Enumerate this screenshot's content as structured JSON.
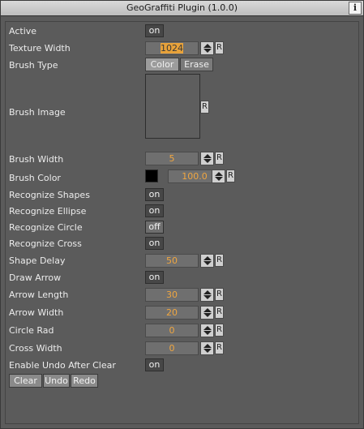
{
  "window": {
    "title": "GeoGraffiti Plugin (1.0.0)",
    "info_label": "i"
  },
  "common": {
    "reset_label": "R"
  },
  "rows": {
    "active": {
      "label": "Active",
      "toggle": "on"
    },
    "texture_width": {
      "label": "Texture Width",
      "value_a": "1",
      "value_b": "024"
    },
    "brush_type": {
      "label": "Brush Type",
      "options": [
        "Color",
        "Erase"
      ]
    },
    "brush_image": {
      "label": "Brush Image"
    },
    "brush_width": {
      "label": "Brush Width",
      "value": "5"
    },
    "brush_color": {
      "label": "Brush Color",
      "swatch": "#000000",
      "value": "100.0"
    },
    "recognize_shapes": {
      "label": "Recognize Shapes",
      "toggle": "on"
    },
    "recognize_ellipse": {
      "label": "Recognize Ellipse",
      "toggle": "on"
    },
    "recognize_circle": {
      "label": "Recognize Circle",
      "toggle": "off"
    },
    "recognize_cross": {
      "label": "Recognize Cross",
      "toggle": "on"
    },
    "shape_delay": {
      "label": "Shape Delay",
      "value": "50"
    },
    "draw_arrow": {
      "label": "Draw Arrow",
      "toggle": "on"
    },
    "arrow_length": {
      "label": "Arrow Length",
      "value": "30"
    },
    "arrow_width": {
      "label": "Arrow Width",
      "value": "20"
    },
    "circle_rad": {
      "label": "Circle Rad",
      "value": "0"
    },
    "cross_width": {
      "label": "Cross Width",
      "value": "0"
    },
    "enable_undo": {
      "label": "Enable Undo After Clear",
      "toggle": "on"
    }
  },
  "actions": {
    "clear": "Clear",
    "undo": "Undo",
    "redo": "Redo"
  },
  "colors": {
    "accent_value": "#f0a640",
    "panel_bg": "#5b5b5b"
  }
}
